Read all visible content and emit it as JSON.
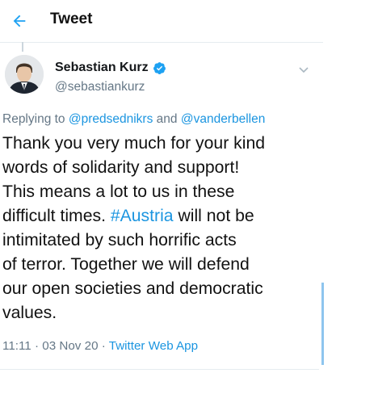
{
  "header": {
    "title": "Tweet",
    "back_icon": "arrow-left-icon"
  },
  "tweet": {
    "author_name": "Sebastian Kurz",
    "handle": "@sebastiankurz",
    "verified_icon": "verified-badge-icon",
    "menu_icon": "chevron-down-icon",
    "reply_prefix": "Replying to",
    "reply_user1": "@predsednikrs",
    "reply_and": "and",
    "reply_user2": "@vanderbellen",
    "text_lines": [
      "Thank you very much for your kind",
      "words of solidarity and support!",
      "This means a lot to us in these",
      "difficult times.",
      "#Austria",
      "will not be",
      "intimitated by such horrific acts",
      "of terror. Together we will defend",
      "our open societies and democratic",
      "values."
    ],
    "time": "11:11",
    "date": "03 Nov 20",
    "separator": "·",
    "source": "Twitter Web App"
  },
  "colors": {
    "link": "#1b95e0",
    "secondary_text": "#657786",
    "verified": "#1da1f2"
  }
}
